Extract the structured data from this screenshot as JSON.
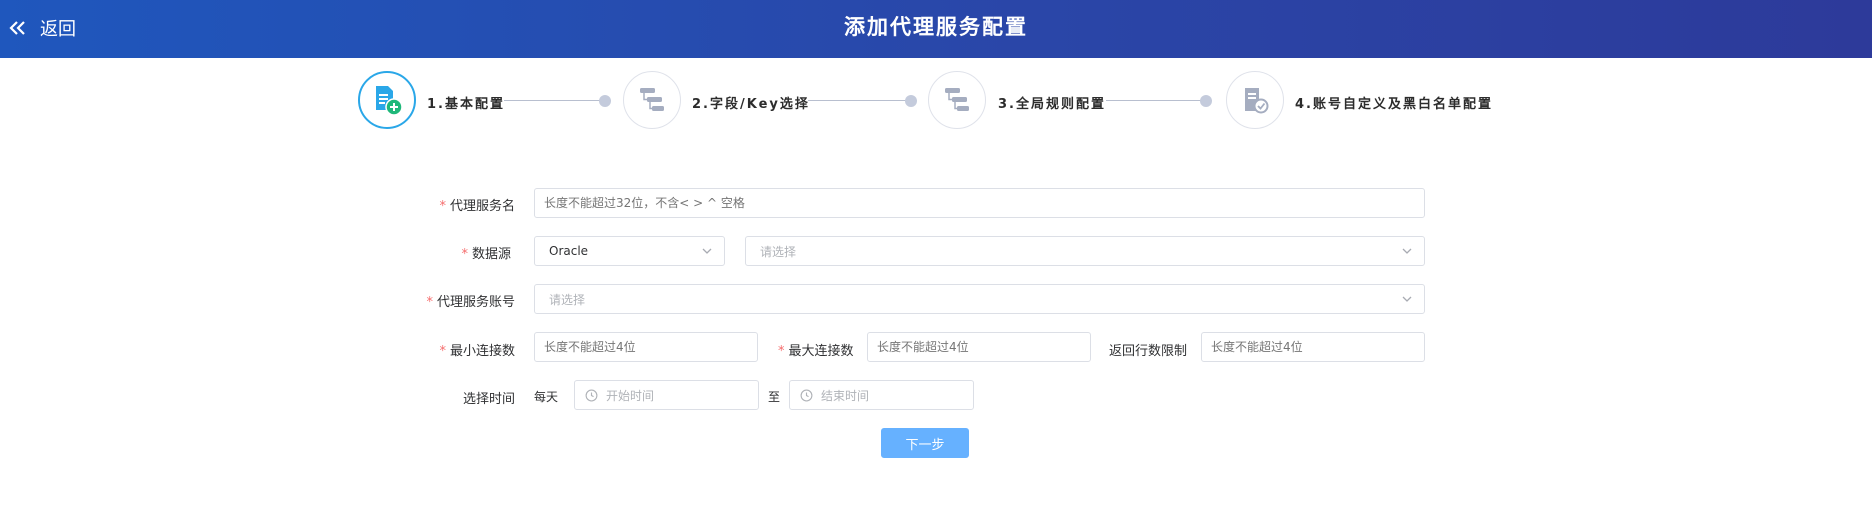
{
  "header": {
    "back_label": "返回",
    "title": "添加代理服务配置",
    "gradient_start": "#1f57bd",
    "gradient_end": "#2d3a9a"
  },
  "steps": [
    {
      "label": "1.基本配置",
      "icon": "document-add-icon",
      "active": true
    },
    {
      "label": "2.字段/Key选择",
      "icon": "tree-structure-icon",
      "active": false
    },
    {
      "label": "3.全局规则配置",
      "icon": "tree-structure-icon",
      "active": false
    },
    {
      "label": "4.账号自定义及黑白名单配置",
      "icon": "document-check-icon",
      "active": false
    }
  ],
  "form": {
    "proxy_name": {
      "label": "代理服务名",
      "required": true,
      "placeholder": "长度不能超过32位，不含< > ^ 空格"
    },
    "datasource": {
      "label": "数据源",
      "required": true,
      "type_value": "Oracle",
      "source_placeholder": "请选择"
    },
    "proxy_account": {
      "label": "代理服务账号",
      "required": true,
      "placeholder": "请选择"
    },
    "min_conn": {
      "label": "最小连接数",
      "required": true,
      "placeholder": "长度不能超过4位"
    },
    "max_conn": {
      "label": "最大连接数",
      "required": true,
      "placeholder": "长度不能超过4位"
    },
    "row_limit": {
      "label": "返回行数限制",
      "required": false,
      "placeholder": "长度不能超过4位"
    },
    "time": {
      "label": "选择时间",
      "prefix": "每天",
      "start_placeholder": "开始时间",
      "separator": "至",
      "end_placeholder": "结束时间"
    },
    "required_mark": "*"
  },
  "actions": {
    "next_label": "下一步",
    "primary_color": "#66b1ff"
  }
}
